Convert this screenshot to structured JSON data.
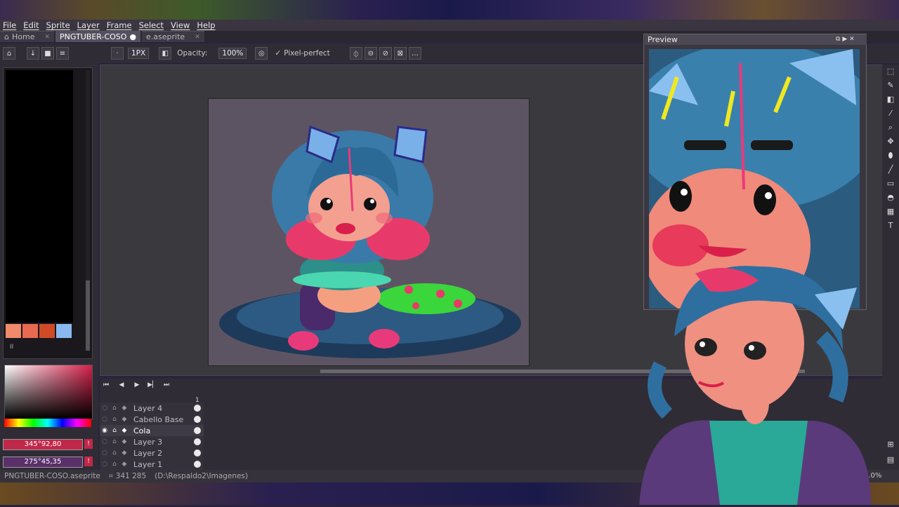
{
  "menubar": [
    "File",
    "Edit",
    "Sprite",
    "Layer",
    "Frame",
    "Select",
    "View",
    "Help"
  ],
  "tabs": [
    {
      "label": "Home",
      "active": false
    },
    {
      "label": "PNGTUBER-COSO",
      "active": true
    },
    {
      "label": "e.aseprite",
      "active": false
    }
  ],
  "toolbar": {
    "brush_size": "1PX",
    "opacity_label": "Opacity:",
    "opacity_value": "100%",
    "pixel_perfect": "Pixel-perfect"
  },
  "palette": {
    "swatches": [
      "#f08a6a",
      "#e86a50",
      "#d04a28",
      "#8ab8f0"
    ],
    "index_label": "II"
  },
  "color_fields": {
    "fg": "345°92,80",
    "bg": "275°45,35",
    "fg_color": "#c0284a",
    "bg_color": "#5a2f6a"
  },
  "layers": [
    {
      "name": "Layer 4",
      "selected": false
    },
    {
      "name": "Cabello Base",
      "selected": false
    },
    {
      "name": "Cola",
      "selected": true
    },
    {
      "name": "Layer 3",
      "selected": false
    },
    {
      "name": "Layer 2",
      "selected": false
    },
    {
      "name": "Layer 1",
      "selected": false
    }
  ],
  "frame_number": "1",
  "status": {
    "file": "PNGTUBER-COSO.aseprite",
    "coords": "341 285",
    "path": "(D:\\Respaldo2\\Imagenes)",
    "zoom": "0.0%"
  },
  "preview": {
    "title": "Preview"
  }
}
